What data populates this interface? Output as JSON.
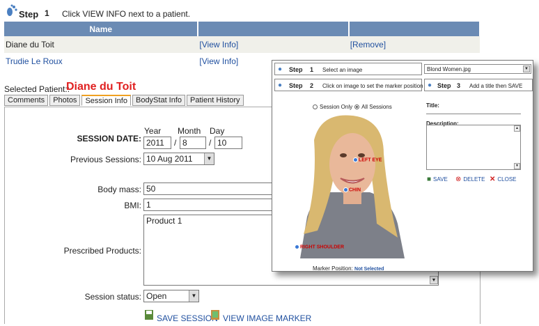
{
  "step1": {
    "label": "Step",
    "num": "1",
    "instruction": "Click VIEW INFO next to a patient."
  },
  "table": {
    "headers": [
      "Name",
      "",
      ""
    ],
    "rows": [
      {
        "name": "Diane du Toit",
        "view": "[View Info]",
        "remove": "[Remove]"
      },
      {
        "name": "Trudie Le Roux",
        "view": "[View Info]"
      }
    ]
  },
  "selected": {
    "label": "Selected Patient::",
    "name": "Diane du Toit"
  },
  "tabs": [
    "Comments",
    "Photos",
    "Session Info",
    "BodyStat Info",
    "Patient History"
  ],
  "form": {
    "session_date_label": "SESSION DATE:",
    "year_label": "Year",
    "month_label": "Month",
    "day_label": "Day",
    "year": "2011",
    "month": "8",
    "day": "10",
    "sep": "/",
    "prev_sessions_label": "Previous Sessions:",
    "prev_sessions": "10 Aug 2011",
    "body_mass_label": "Body mass:",
    "body_mass": "50",
    "bmi_label": "BMI:",
    "bmi": "1",
    "products_label": "Prescribed Products:",
    "products": "Product 1",
    "status_label": "Session status:",
    "status": "Open",
    "save_session": "SAVE SESSION",
    "view_marker": "VIEW IMAGE MARKER"
  },
  "popup": {
    "step1": {
      "label": "Step",
      "num": "1",
      "text": "Select an image"
    },
    "image_select": "Blond Women.jpg",
    "step2": {
      "label": "Step",
      "num": "2",
      "text": "Click on image to set the marker position"
    },
    "step3": {
      "label": "Step",
      "num": "3",
      "text": "Add a title then SAVE"
    },
    "session_only": "Session Only",
    "all_sessions": "All Sessions",
    "title_label": "Title:",
    "description_label": "Description:",
    "save": "SAVE",
    "delete": "DELETE",
    "close": "CLOSE",
    "markers": [
      "LEFT EYE",
      "CHIN",
      "RIGHT SHOULDER"
    ],
    "marker_position_label": "Marker Position:",
    "marker_position_value": "Not Selected"
  },
  "colors": {
    "header_bg": "#6b8bb4",
    "link": "#1f4f9f",
    "patient_name": "#e02020",
    "marker": "#cc0000"
  }
}
